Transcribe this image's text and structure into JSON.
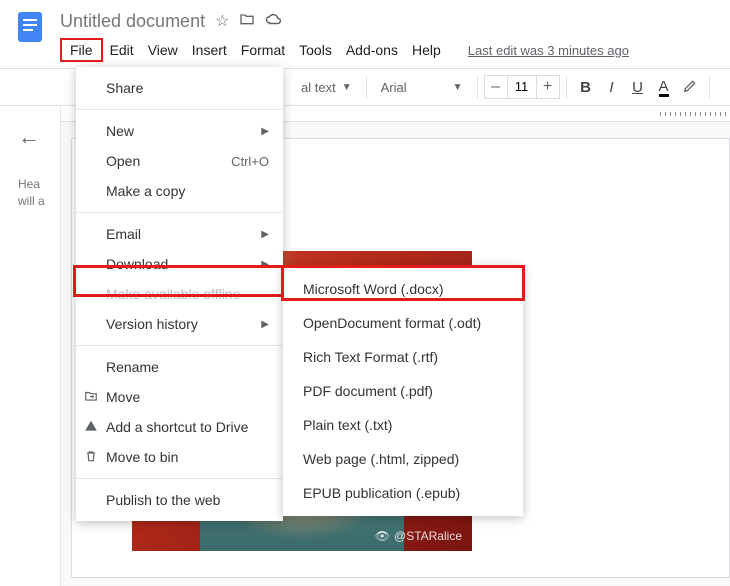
{
  "header": {
    "title": "Untitled document",
    "last_edit": "Last edit was 3 minutes ago"
  },
  "menubar": [
    "File",
    "Edit",
    "View",
    "Insert",
    "Format",
    "Tools",
    "Add-ons",
    "Help"
  ],
  "toolbar": {
    "style_select": "al text",
    "font": "Arial",
    "font_size": "11",
    "minus": "–",
    "plus": "+",
    "bold": "B",
    "italic": "I",
    "underline": "U",
    "text_color": "A"
  },
  "outline": {
    "text": "Hea\nwill a"
  },
  "file_menu": {
    "share": "Share",
    "new": "New",
    "open": "Open",
    "open_shortcut": "Ctrl+O",
    "make_copy": "Make a copy",
    "email": "Email",
    "download": "Download",
    "offline": "Make available offline",
    "version": "Version history",
    "rename": "Rename",
    "move": "Move",
    "shortcut": "Add a shortcut to Drive",
    "bin": "Move to bin",
    "publish": "Publish to the web"
  },
  "download_menu": [
    "Microsoft Word (.docx)",
    "OpenDocument format (.odt)",
    "Rich Text Format (.rtf)",
    "PDF document (.pdf)",
    "Plain text (.txt)",
    "Web page (.html, zipped)",
    "EPUB publication (.epub)"
  ],
  "image": {
    "watermark": "@STARalice"
  }
}
